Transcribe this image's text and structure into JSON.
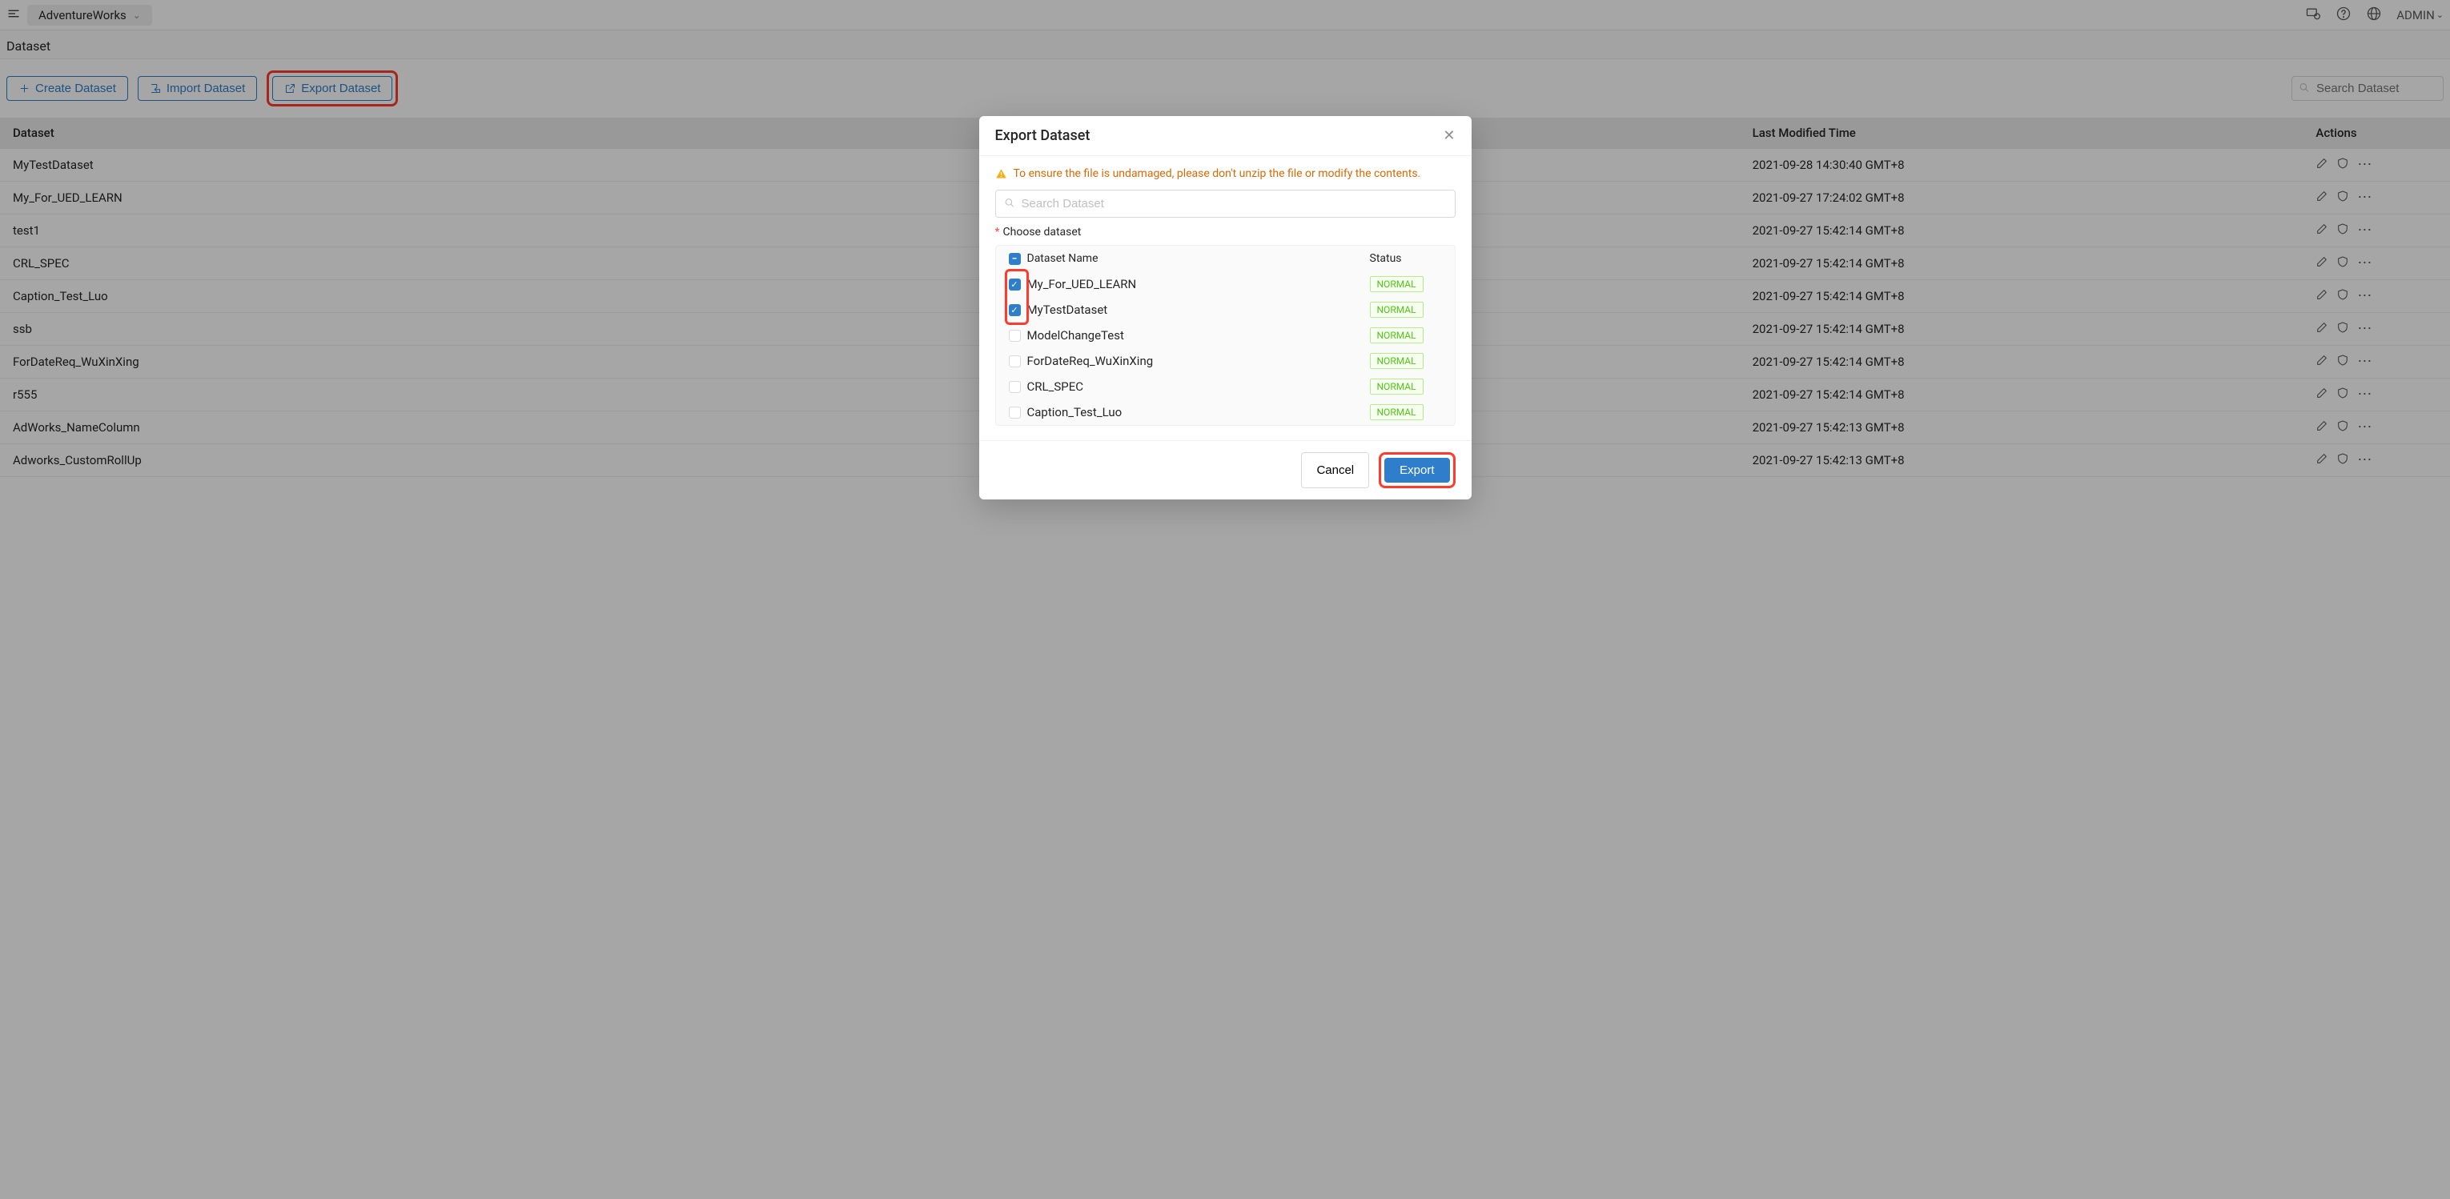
{
  "topbar": {
    "project": "AdventureWorks",
    "user": "ADMIN"
  },
  "page": {
    "title": "Dataset"
  },
  "toolbar": {
    "create": "Create Dataset",
    "import": "Import Dataset",
    "export": "Export Dataset",
    "search_placeholder": "Search Dataset"
  },
  "table": {
    "headers": {
      "dataset": "Dataset",
      "modified": "Last Modified Time",
      "actions": "Actions"
    },
    "rows": [
      {
        "name": "MyTestDataset",
        "modified": "2021-09-28 14:30:40 GMT+8"
      },
      {
        "name": "My_For_UED_LEARN",
        "modified": "2021-09-27 17:24:02 GMT+8"
      },
      {
        "name": "test1",
        "modified": "2021-09-27 15:42:14 GMT+8"
      },
      {
        "name": "CRL_SPEC",
        "modified": "2021-09-27 15:42:14 GMT+8"
      },
      {
        "name": "Caption_Test_Luo",
        "modified": "2021-09-27 15:42:14 GMT+8"
      },
      {
        "name": "ssb",
        "modified": "2021-09-27 15:42:14 GMT+8"
      },
      {
        "name": "ForDateReq_WuXinXing",
        "modified": "2021-09-27 15:42:14 GMT+8"
      },
      {
        "name": "r555",
        "modified": "2021-09-27 15:42:14 GMT+8"
      },
      {
        "name": "AdWorks_NameColumn",
        "modified": "2021-09-27 15:42:13 GMT+8"
      },
      {
        "name": "Adworks_CustomRollUp",
        "modified": "2021-09-27 15:42:13 GMT+8"
      }
    ]
  },
  "modal": {
    "title": "Export Dataset",
    "warning": "To ensure the file is undamaged, please don't unzip the file or modify the contents.",
    "search_placeholder": "Search Dataset",
    "choose_label": "Choose dataset",
    "header_name": "Dataset Name",
    "header_status": "Status",
    "status_normal": "NORMAL",
    "items": [
      {
        "name": "My_For_UED_LEARN",
        "checked": true
      },
      {
        "name": "MyTestDataset",
        "checked": true
      },
      {
        "name": "ModelChangeTest",
        "checked": false
      },
      {
        "name": "ForDateReq_WuXinXing",
        "checked": false
      },
      {
        "name": "CRL_SPEC",
        "checked": false
      },
      {
        "name": "Caption_Test_Luo",
        "checked": false
      }
    ],
    "cancel": "Cancel",
    "export": "Export"
  }
}
